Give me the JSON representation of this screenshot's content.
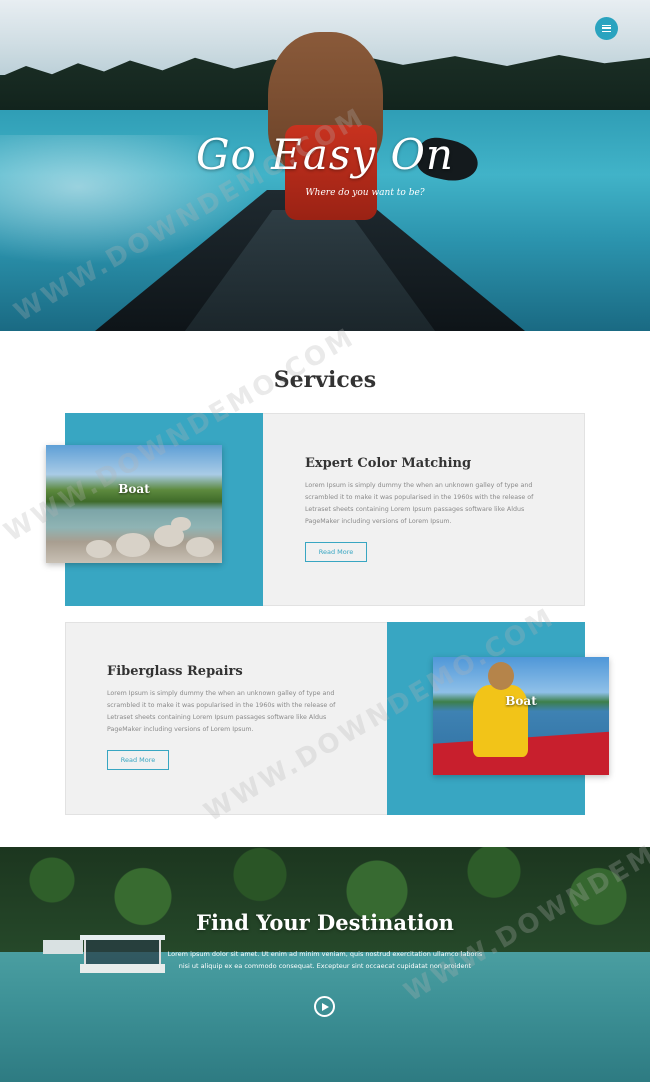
{
  "hero": {
    "title": "Go Easy On",
    "subtitle": "Where do you want to be?",
    "menu_icon": "hamburger-menu-icon"
  },
  "services": {
    "heading": "Services",
    "items": [
      {
        "title": "Expert Color Matching",
        "text": "Lorem Ipsum is simply dummy the when an unknown galley of type and scrambled it to make it was popularised in the 1960s with the release of Letraset sheets containing Lorem Ipsum passages software like Aldus PageMaker including versions of Lorem Ipsum.",
        "button": "Read More",
        "image_caption": "Boat"
      },
      {
        "title": "Fiberglass Repairs",
        "text": "Lorem Ipsum is simply dummy the when an unknown galley of type and scrambled it to make it was popularised in the 1960s with the release of Letraset sheets containing Lorem Ipsum passages software like Aldus PageMaker including versions of Lorem Ipsum.",
        "button": "Read More",
        "image_caption": "Boat"
      }
    ]
  },
  "destination": {
    "title": "Find Your Destination",
    "text": "Lorem ipsum dolor sit amet. Ut enim ad minim veniam, quis nostrud exercitation ullamco laboris nisi ut aliquip ex ea commodo consequat. Excepteur sint occaecat cupidatat non proident",
    "play_icon": "play-circle-icon"
  },
  "watermark": "WWW.DOWNDEMO.COM",
  "colors": {
    "accent": "#38a6c2",
    "card_bg": "#f1f1f1",
    "heading": "#333333"
  }
}
